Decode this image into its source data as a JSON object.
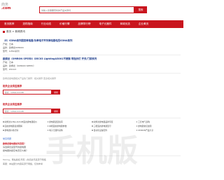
{
  "header": {
    "logo_top": "商务",
    "logo_bottom": ".com",
    "search_placeholder": "请输入您需要查找的产品关键词",
    "search_button": "搜索"
  },
  "nav": [
    "首页推荐",
    "选购指南",
    "行业动态",
    "价格行情",
    "品牌排行榜",
    "电子元器件",
    "商城优选",
    "企业黄页"
  ],
  "breadcrumb": "首页 > 新闻资讯",
  "product": {
    "title": "（E）G3NA系列固态继电器/功率电子开关继电器电压G3NA系列",
    "lines": [
      "产地：日本",
      "品牌：欧姆龙OMRON",
      "型号：G3NA系列"
    ]
  },
  "product2": {
    "title": "欧姆龙（OMRON SPEED）D5C03 LightingA3001不锈钢 带指示灯 开关/门禁系列",
    "lines": [
      "产地：日本",
      "品牌：欧姆龙（OMRON SPEED）",
      "型号：D5C03"
    ]
  },
  "related_note": "欧姆龙继电器相关产品热门推荐：相关推荐 更多相关推荐",
  "section_a": {
    "title": "相关企业供应推荐",
    "input_placeholder": "搜索：G3NA-D210B",
    "button": "搜索"
  },
  "section_b": {
    "title": "相关企业供应推荐",
    "input_placeholder": "搜索：G3NA-D210B",
    "button": "搜索"
  },
  "grid": [
    [
      "欧姆龙G3NA-D210B固态继电器报价",
      "继电器选型指南",
      "欧姆龙继电器品牌专区",
      "工控电气选购"
    ],
    [
      "固态继电器接线图解",
      "单相固态继电器参数",
      "三相固态继电器型号",
      "继电器常见故障"
    ],
    [
      "继电器价格行情",
      "电子元器件采购",
      "自动化设备配件",
      "OMRON产品大全"
    ]
  ],
  "faq": {
    "head": "常见问题",
    "lines": [
      "欧姆龙继电器如何选型？",
      "请选择合适型号的继电器",
      "继电器的额定电流怎么看？"
    ]
  },
  "footer": {
    "line1": "Tokmg，网站版权 所有 | 新闻资讯来源于网络",
    "line2": "客服：本站部分内容来源于网络，仅供参考"
  },
  "watermark": "手机版"
}
